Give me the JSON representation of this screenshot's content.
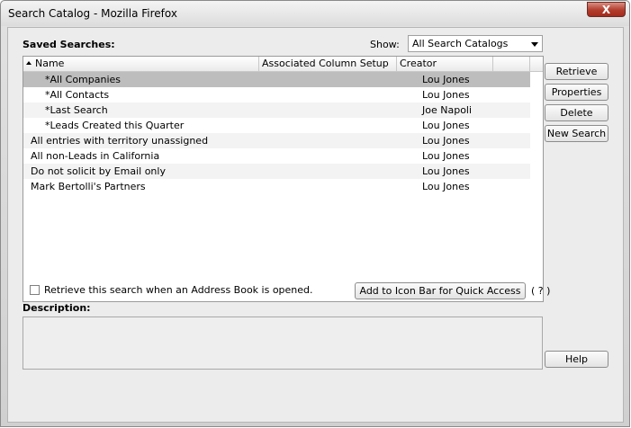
{
  "window": {
    "title": "Search Catalog - Mozilla Firefox",
    "close_glyph": "X"
  },
  "saved_searches_label": "Saved Searches:",
  "show": {
    "label": "Show:",
    "selected": "All Search Catalogs"
  },
  "table": {
    "columns": [
      "Name",
      "Associated Column Setup",
      "Creator"
    ],
    "rows": [
      {
        "name": "*All Companies",
        "column_setup": "",
        "creator": "Lou Jones",
        "selected": true
      },
      {
        "name": "*All Contacts",
        "column_setup": "",
        "creator": "Lou Jones"
      },
      {
        "name": "*Last Search",
        "column_setup": "",
        "creator": "Joe Napoli"
      },
      {
        "name": "*Leads Created this Quarter",
        "column_setup": "",
        "creator": "Lou Jones"
      },
      {
        "name": "All entries with territory unassigned",
        "column_setup": "",
        "creator": "Lou Jones"
      },
      {
        "name": "All non-Leads in California",
        "column_setup": "",
        "creator": "Lou Jones"
      },
      {
        "name": "Do not solicit by Email only",
        "column_setup": "",
        "creator": "Lou Jones"
      },
      {
        "name": "Mark Bertolli's Partners",
        "column_setup": "",
        "creator": "Lou Jones"
      }
    ]
  },
  "buttons": {
    "retrieve": "Retrieve",
    "properties": "Properties",
    "delete": "Delete",
    "new_search": "New Search",
    "help": "Help",
    "add_icon_bar": "Add to Icon Bar for Quick Access"
  },
  "retrieve_checkbox": {
    "label": "Retrieve this search when an Address Book is opened.",
    "checked": false
  },
  "help_link": "( ? )",
  "description": {
    "label": "Description:",
    "value": ""
  }
}
